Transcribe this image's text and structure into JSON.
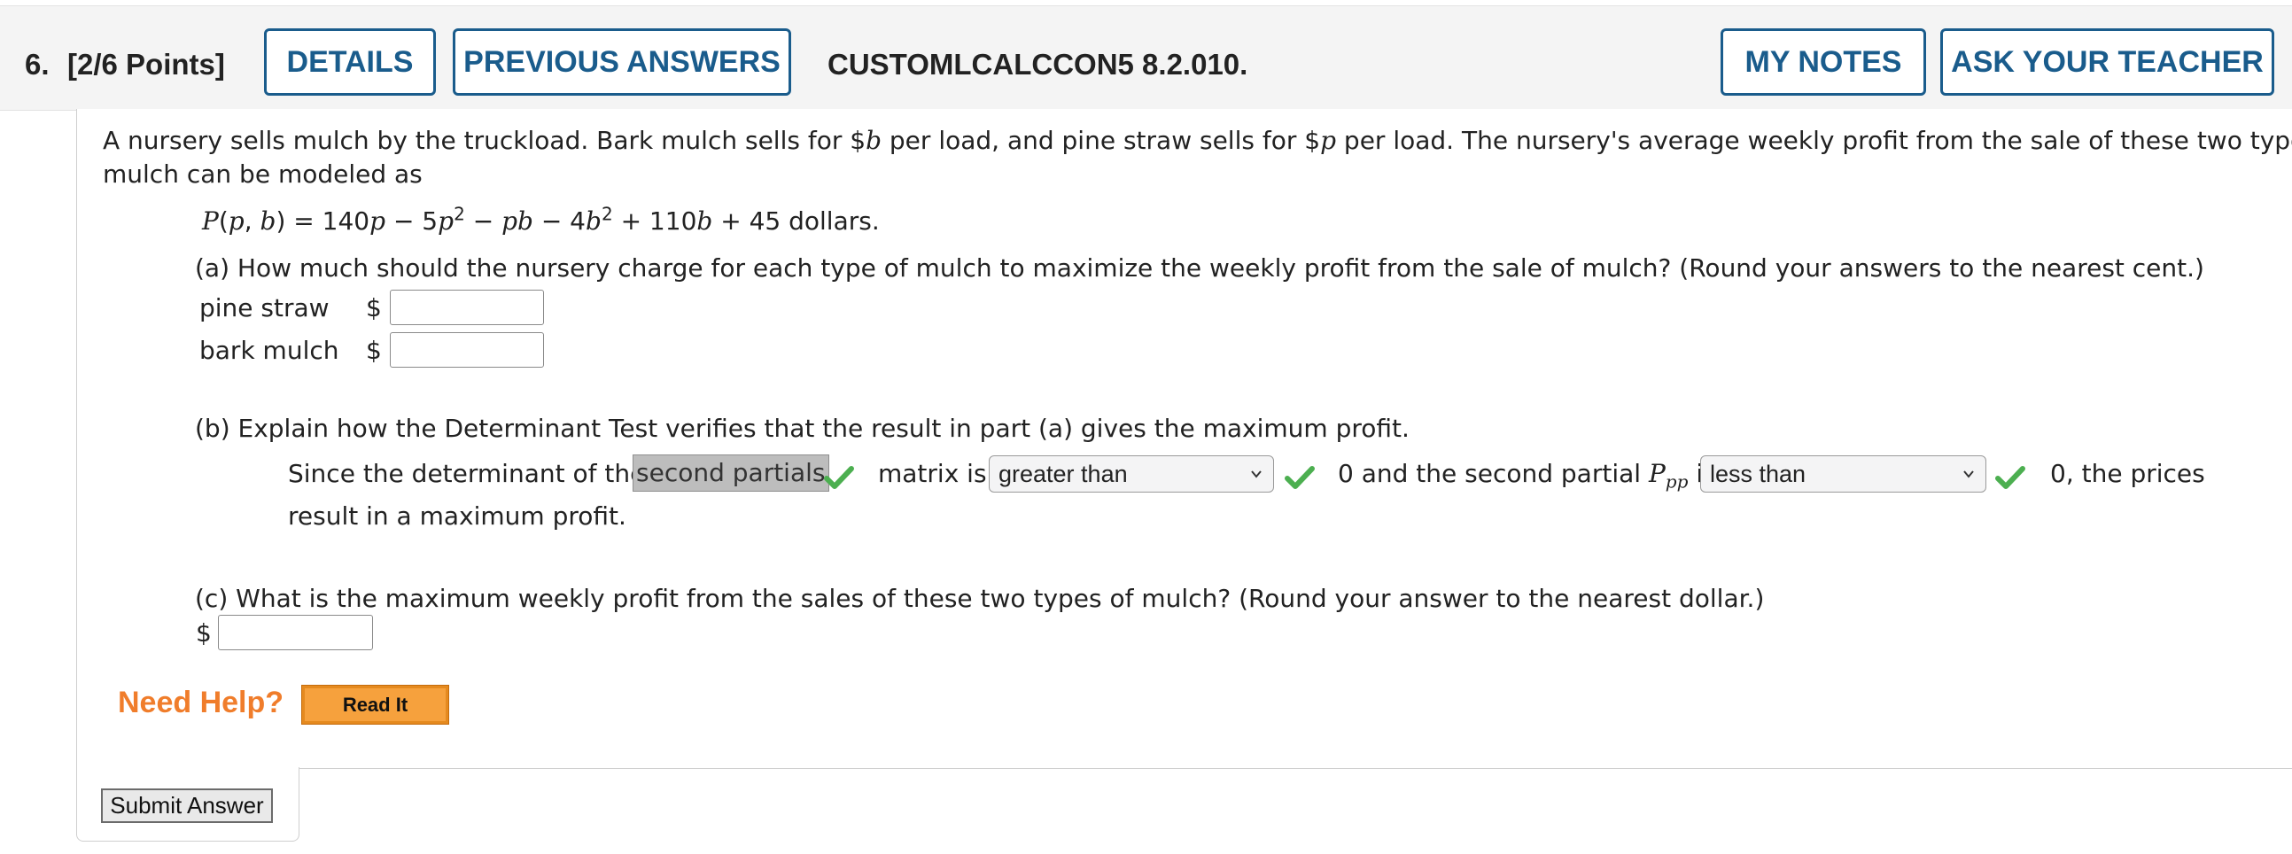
{
  "header": {
    "number": "6.",
    "points": "[2/6 Points]",
    "details_label": "DETAILS",
    "previous_answers_label": "PREVIOUS ANSWERS",
    "problem_code": "CUSTOMLCALCCON5 8.2.010.",
    "my_notes_label": "MY NOTES",
    "ask_teacher_label": "ASK YOUR TEACHER"
  },
  "problem": {
    "intro_line1_a": "A nursery sells mulch by the truckload. Bark mulch sells for $",
    "intro_var_b": "b",
    "intro_line1_b": " per load, and pine straw sells for $",
    "intro_var_p": "p",
    "intro_line1_c": " per load. The nursery's average weekly profit from the sale of these two types of",
    "intro_line2": "mulch can be modeled as",
    "formula_units": " dollars."
  },
  "part_a": {
    "question": "(a) How much should the nursery charge for each type of mulch to maximize the weekly profit from the sale of mulch? (Round your answers to the nearest cent.)",
    "rows": [
      {
        "label": "pine straw",
        "currency": "$",
        "value": ""
      },
      {
        "label": "bark mulch",
        "currency": "$",
        "value": ""
      }
    ]
  },
  "part_b": {
    "question": "(b) Explain how the Determinant Test verifies that the result in part (a) gives the maximum profit.",
    "text_since": "Since the determinant of the",
    "answer_chip": "second partials",
    "text_matrix_is": "matrix is",
    "select1_value": "greater than",
    "text_zero_and": "0 and the second partial",
    "partial_symbol": "P",
    "partial_subscript": "pp",
    "text_is": "is",
    "select2_value": "less than",
    "text_zero_prices": "0, the prices",
    "text_result": "result in a maximum profit."
  },
  "part_c": {
    "question": "(c) What is the maximum weekly profit from the sales of these two types of mulch? (Round your answer to the nearest dollar.)",
    "currency": "$",
    "value": ""
  },
  "help": {
    "need_help": "Need Help?",
    "read_it": "Read It"
  },
  "submit_label": "Submit Answer",
  "colors": {
    "accent": "#1a5c8c",
    "check": "#4caf50",
    "help_orange": "#f07d2b",
    "read_it_bg": "#f6a13d"
  }
}
